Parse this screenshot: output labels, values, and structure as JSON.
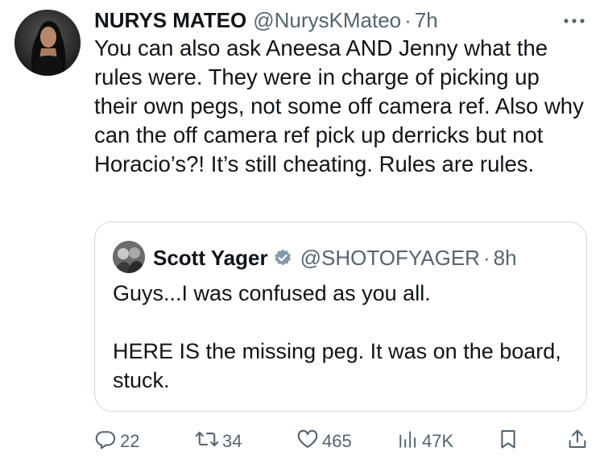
{
  "tweet": {
    "author": {
      "display_name": "NURYS MATEO",
      "handle": "@NurysKMateo",
      "separator": "·",
      "time": "7h"
    },
    "more_icon": "more-horizontal-icon",
    "text": "You can also ask Aneesa AND Jenny what the rules were. They were in charge of picking up their own pegs, not some off camera ref. Also why can the off camera ref pick up derricks but not Horacio’s?! It’s still cheating. Rules are rules.",
    "quote": {
      "display_name": "Scott Yager",
      "verified_icon": "verified-badge-icon",
      "handle": "@SHOTOFYAGER",
      "separator": "·",
      "time": "8h",
      "paragraph_1": "Guys...I was confused as you all.",
      "paragraph_2": "HERE IS the missing peg. It was on the board, stuck."
    },
    "actions": {
      "reply_count": "22",
      "retweet_count": "34",
      "like_count": "465",
      "view_count": "47K",
      "icons": [
        "reply-icon",
        "retweet-icon",
        "like-icon",
        "views-icon",
        "bookmark-icon",
        "share-icon"
      ]
    }
  },
  "colors": {
    "text": "#0f1419",
    "secondary": "#536471",
    "border": "#cfd9de",
    "verified_badge": "#829aab"
  }
}
